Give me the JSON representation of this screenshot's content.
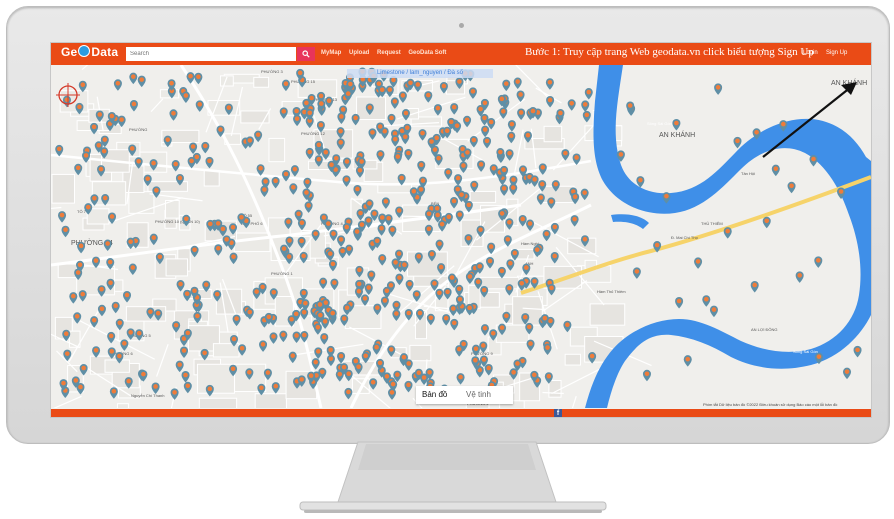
{
  "app": {
    "logo": "GeoData",
    "search_placeholder": "Search",
    "nav": [
      "MyMap",
      "Upload",
      "Request",
      "GeoData Soft"
    ],
    "instruction": "Bước 1: Truy cập trang Web geodata.vn click biểu tượng Sign Up",
    "login_label": "Login",
    "signup_label": "Sign Up"
  },
  "map": {
    "breadcrumb": "Limestone / lam_nguyen / Đà số",
    "labels": [
      "PHƯỜNG 3",
      "PHƯỜNG 15",
      "PHƯỜNG 13",
      "PHƯỜNG",
      "PHƯỜNG 12",
      "PHƯỜNG 14",
      "TÔ 7",
      "TÔ 55",
      "KHU PHỐ 6",
      "PHƯỜNG 10 (QUẬN 10)",
      "PHƯỜNG 1",
      "PHƯỜNG 4",
      "PHƯỜNG 5",
      "PHƯỜNG 6",
      "PHƯỜNG 9",
      "BẾN",
      "ANH",
      "Hàm Nghi",
      "AN KHÁNH",
      "AN KHÁNH",
      "Đ. Mai Chí Thọ",
      "Hầm Thủ Thiêm",
      "AN LỢI ĐÔNG",
      "THỦ THIÊM",
      "Sông Sài Gòn",
      "Sông Sài Gòn",
      "Nguyễn Chí Thanh",
      "PHƯỜNG 2",
      "PHÚ",
      "Tân Hội"
    ],
    "map_type": {
      "map": "Bản đồ",
      "satellite": "Vệ tinh"
    },
    "attribution": "Phím tắt   Dữ liệu bản đồ ©2022   Điều khoản sử dụng   Báo cáo một lỗi bản đồ",
    "colors": {
      "topbar": "#ea4b16",
      "river": "#3f8fe8",
      "road_major": "#f6d36a",
      "pin": "#5f8fa6"
    }
  }
}
